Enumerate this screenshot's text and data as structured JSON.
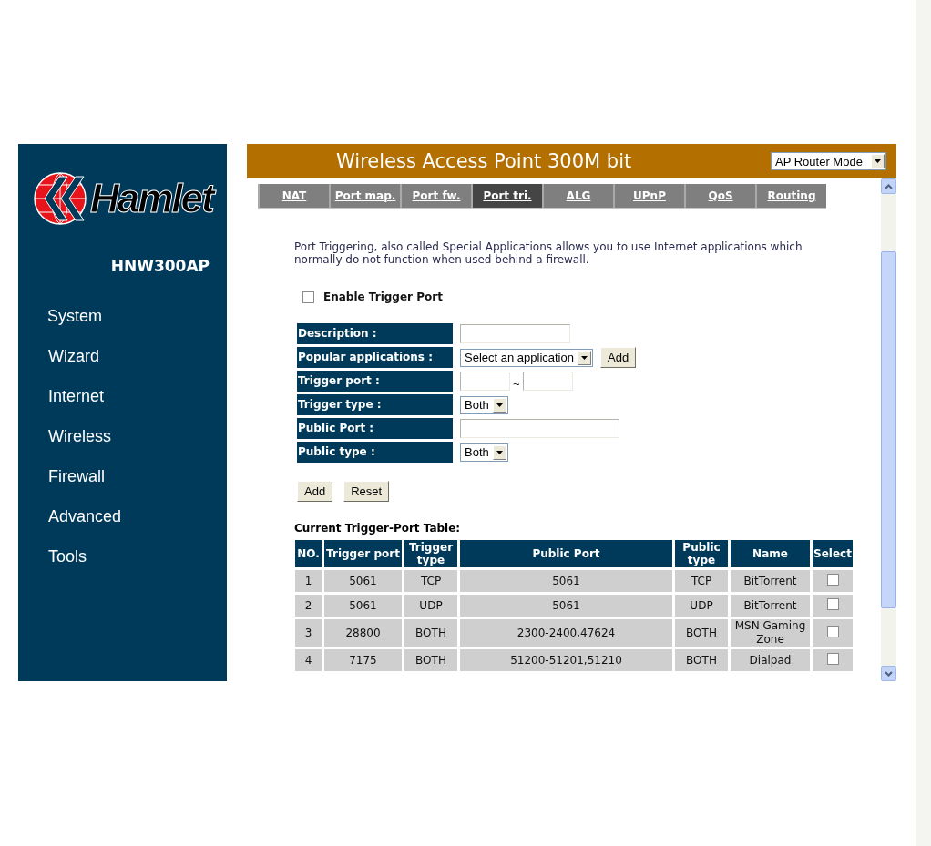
{
  "sidebar": {
    "logo": "Hamlet",
    "model": "HNW300AP",
    "items": [
      {
        "label": "System"
      },
      {
        "label": "Wizard"
      },
      {
        "label": "Internet"
      },
      {
        "label": "Wireless"
      },
      {
        "label": "Firewall"
      },
      {
        "label": "Advanced"
      },
      {
        "label": "Tools"
      }
    ]
  },
  "header": {
    "title": "Wireless Access Point 300M bit",
    "mode_select": "AP Router Mode"
  },
  "tabs": [
    {
      "label": "NAT",
      "selected": false
    },
    {
      "label": "Port map.",
      "selected": false
    },
    {
      "label": "Port fw.",
      "selected": false
    },
    {
      "label": "Port tri.",
      "selected": true
    },
    {
      "label": "ALG",
      "selected": false
    },
    {
      "label": "UPnP",
      "selected": false
    },
    {
      "label": "QoS",
      "selected": false
    },
    {
      "label": "Routing",
      "selected": false
    }
  ],
  "intro": "Port Triggering, also called Special Applications allows you to use Internet applications which normally do not function when used behind a firewall.",
  "enable_trigger": {
    "label": "Enable Trigger Port",
    "checked": false
  },
  "form": {
    "rows": [
      {
        "label": "Description :",
        "kind": "text"
      },
      {
        "label": "Popular applications :",
        "kind": "select",
        "value": "Select an application",
        "button": "Add"
      },
      {
        "label": "Trigger port :",
        "kind": "range",
        "separator": "~"
      },
      {
        "label": "Trigger type :",
        "kind": "select",
        "value": "Both"
      },
      {
        "label": "Public Port :",
        "kind": "wide"
      },
      {
        "label": "Public type :",
        "kind": "select",
        "value": "Both"
      }
    ],
    "buttons": [
      "Add",
      "Reset"
    ]
  },
  "table": {
    "title": "Current Trigger-Port Table:",
    "columns": [
      "NO.",
      "Trigger port",
      "Trigger type",
      "Public Port",
      "Public type",
      "Name",
      "Select"
    ],
    "rows": [
      {
        "cells": [
          "1",
          "5061",
          "TCP",
          "5061",
          "TCP",
          "BitTorrent"
        ],
        "checked": false
      },
      {
        "cells": [
          "2",
          "5061",
          "UDP",
          "5061",
          "UDP",
          "BitTorrent"
        ],
        "checked": false
      },
      {
        "cells": [
          "3",
          "28800",
          "BOTH",
          "2300-2400,47624",
          "BOTH",
          "MSN Gaming Zone"
        ],
        "checked": false
      },
      {
        "cells": [
          "4",
          "7175",
          "BOTH",
          "51200-51201,51210",
          "BOTH",
          "Dialpad"
        ],
        "checked": false
      }
    ]
  }
}
